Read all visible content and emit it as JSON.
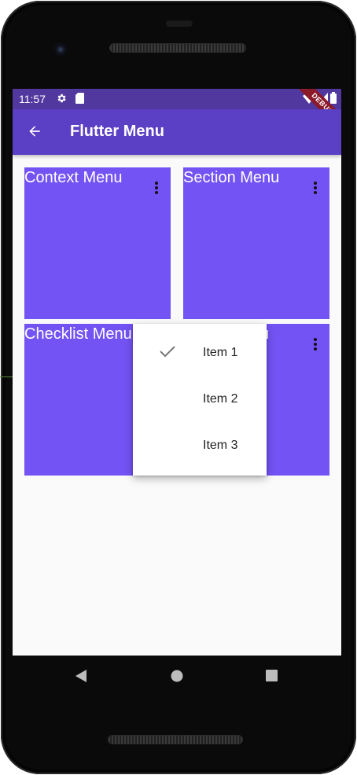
{
  "status_bar": {
    "time": "11:57",
    "icons": [
      "gear-icon",
      "sd-card-icon",
      "wifi-icon",
      "signal-icon",
      "battery-icon"
    ],
    "debug_label": "DEBUG"
  },
  "app_bar": {
    "title": "Flutter Menu",
    "back_icon": "arrow-back-icon",
    "color": "#5b3fc4"
  },
  "cards": [
    {
      "label": "Context Menu",
      "color": "#7353f3"
    },
    {
      "label": "Section Menu",
      "color": "#7353f3"
    },
    {
      "label": "Checklist Menu",
      "color": "#7353f3"
    },
    {
      "label": "u",
      "color": "#7353f3"
    }
  ],
  "popup_menu": {
    "items": [
      {
        "label": "Item 1",
        "checked": true
      },
      {
        "label": "Item 2",
        "checked": false
      },
      {
        "label": "Item 3",
        "checked": false
      }
    ]
  },
  "nav_bar": {
    "buttons": [
      "back-triangle-icon",
      "home-circle-icon",
      "recents-square-icon"
    ]
  }
}
